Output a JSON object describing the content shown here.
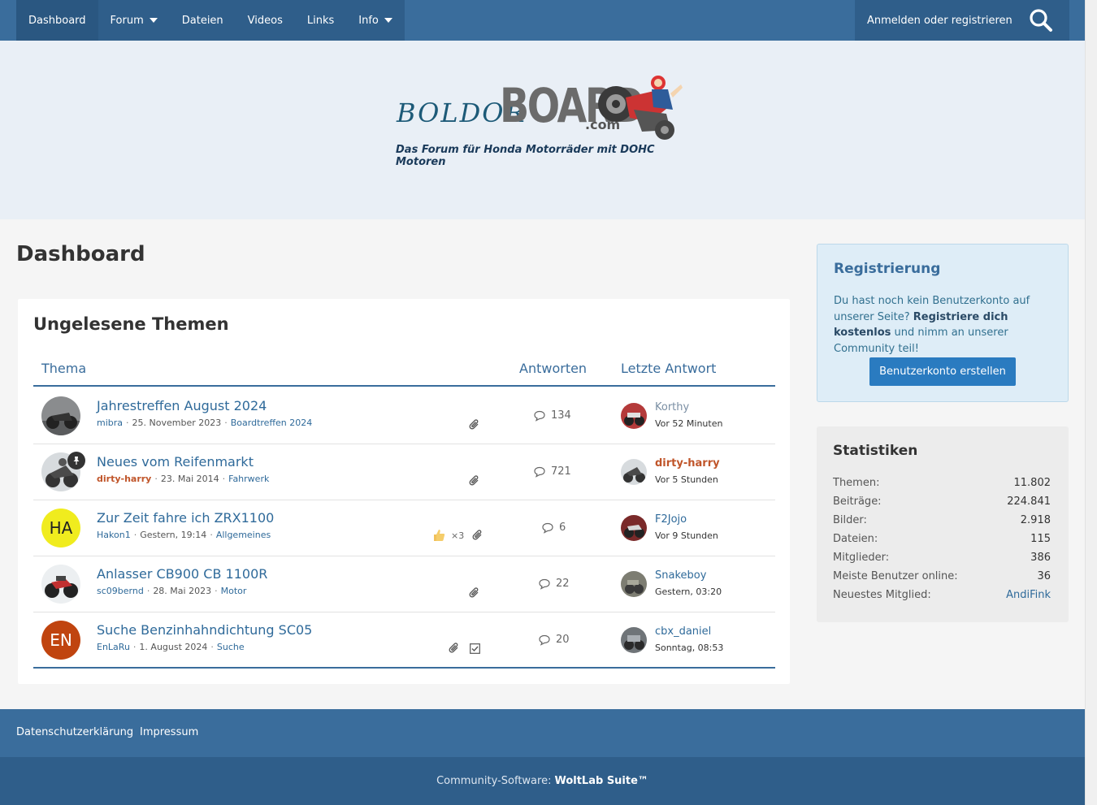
{
  "nav": {
    "items": [
      {
        "label": "Dashboard",
        "dropdown": false
      },
      {
        "label": "Forum",
        "dropdown": true
      },
      {
        "label": "Dateien",
        "dropdown": false
      },
      {
        "label": "Videos",
        "dropdown": false
      },
      {
        "label": "Links",
        "dropdown": false
      },
      {
        "label": "Info",
        "dropdown": true
      }
    ],
    "login": "Anmelden oder registrieren"
  },
  "logo": {
    "part1": "BOLDOR",
    "part2": "BOARD",
    "suffix": ".com",
    "tagline": "Das Forum für Honda Motorräder mit DOHC Motoren"
  },
  "page": {
    "title": "Dashboard"
  },
  "unread": {
    "title": "Ungelesene Themen",
    "columns": {
      "topic": "Thema",
      "replies": "Antworten",
      "last": "Letzte Antwort"
    },
    "rows": [
      {
        "title": "Jahrestreffen August 2024",
        "author": "mibra",
        "date": "25. November 2023",
        "board": "Boardtreffen 2024",
        "replies": "134",
        "last_user": "Korthy",
        "last_time": "Vor 52 Minuten",
        "avatar_initials": "",
        "likes": ""
      },
      {
        "title": "Neues vom Reifenmarkt",
        "author": "dirty-harry",
        "date": "23. Mai 2014",
        "board": "Fahrwerk",
        "replies": "721",
        "last_user": "dirty-harry",
        "last_time": "Vor 5 Stunden",
        "avatar_initials": "",
        "likes": ""
      },
      {
        "title": "Zur Zeit fahre ich ZRX1100",
        "author": "Hakon1",
        "date": "Gestern, 19:14",
        "board": "Allgemeines",
        "replies": "6",
        "last_user": "F2Jojo",
        "last_time": "Vor 9 Stunden",
        "avatar_initials": "HA",
        "likes": "×3"
      },
      {
        "title": "Anlasser CB900 CB 1100R",
        "author": "sc09bernd",
        "date": "28. Mai 2023",
        "board": "Motor",
        "replies": "22",
        "last_user": "Snakeboy",
        "last_time": "Gestern, 03:20",
        "avatar_initials": "",
        "likes": ""
      },
      {
        "title": "Suche Benzinhahndichtung SC05",
        "author": "EnLaRu",
        "date": "1. August 2024",
        "board": "Suche",
        "replies": "20",
        "last_user": "cbx_daniel",
        "last_time": "Sonntag, 08:53",
        "avatar_initials": "EN",
        "likes": ""
      }
    ]
  },
  "registration": {
    "title": "Registrierung",
    "text1": "Du hast noch kein Benutzerkonto auf unserer Seite?",
    "text_bold": "Registriere dich kostenlos",
    "text2": "und nimm an unserer Community teil!",
    "button": "Benutzerkonto erstellen"
  },
  "stats": {
    "title": "Statistiken",
    "items": [
      {
        "label": "Themen:",
        "value": "11.802"
      },
      {
        "label": "Beiträge:",
        "value": "224.841"
      },
      {
        "label": "Bilder:",
        "value": "2.918"
      },
      {
        "label": "Dateien:",
        "value": "115"
      },
      {
        "label": "Mitglieder:",
        "value": "386"
      },
      {
        "label": "Meiste Benutzer online:",
        "value": "36"
      },
      {
        "label": "Neuestes Mitglied:",
        "value": "AndiFink"
      }
    ]
  },
  "footer": {
    "privacy": "Datenschutzerklärung",
    "imprint": "Impressum",
    "software_label": "Community-Software:",
    "software_name": "WoltLab Suite™"
  },
  "colors": {
    "primary": "#3a6d9c",
    "primary_dark": "#2f5e8a",
    "link": "#2f6a9a",
    "highlight_user": "#c0552a",
    "button": "#2a7bc0"
  }
}
